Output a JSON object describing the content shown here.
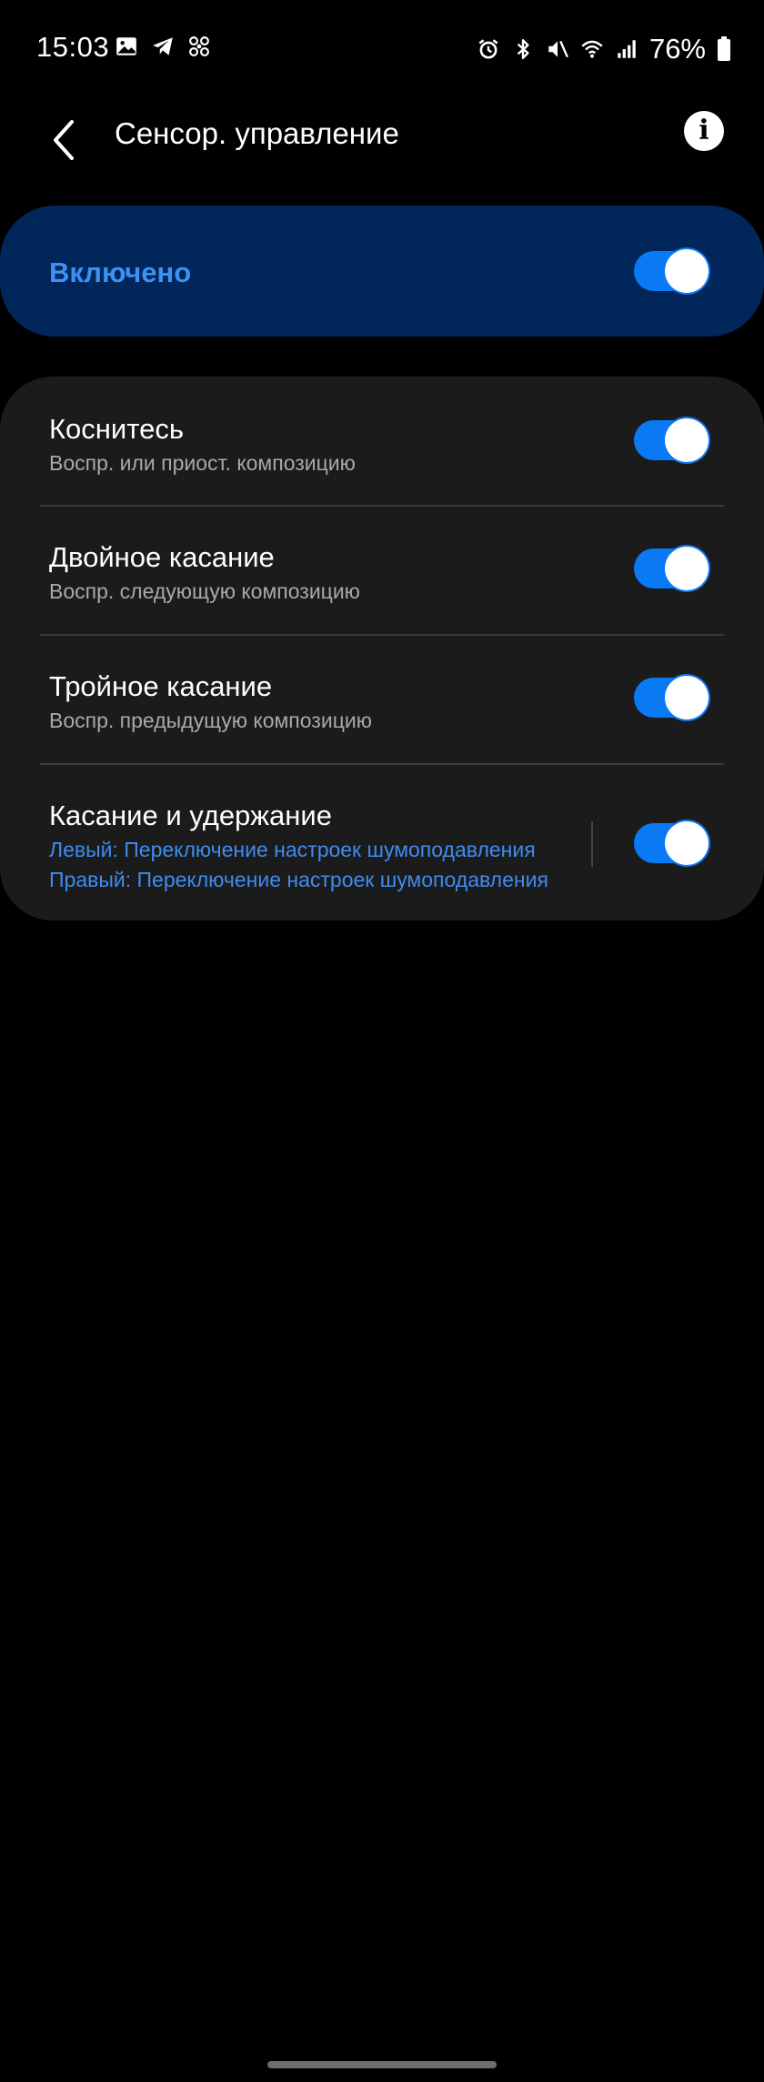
{
  "status_bar": {
    "time": "15:03",
    "left_icons": [
      "gallery-icon",
      "telegram-icon",
      "fan-icon"
    ],
    "right_icons": [
      "alarm-icon",
      "bluetooth-icon",
      "mute-icon",
      "wifi-icon",
      "signal-icon"
    ],
    "battery": "76%"
  },
  "header": {
    "title": "Сенсор. управление",
    "back_icon": "chevron-left-icon",
    "info_icon": "info-icon"
  },
  "master": {
    "label": "Включено",
    "enabled": true
  },
  "items": [
    {
      "title": "Коснитесь",
      "subtitle": "Воспр. или приост. композицию",
      "enabled": true
    },
    {
      "title": "Двойное касание",
      "subtitle": "Воспр. следующую композицию",
      "enabled": true
    },
    {
      "title": "Тройное касание",
      "subtitle": "Воспр. предыдущую композицию",
      "enabled": true
    },
    {
      "title": "Касание и удержание",
      "subtitle_left": "Левый: Переключение настроек шумоподавления",
      "subtitle_right": "Правый: Переключение настроек шумоподавления",
      "enabled": true
    }
  ],
  "colors": {
    "background": "#000000",
    "master_card": "#00265a",
    "accent": "#0a7af4",
    "label_blue": "#3e91f4",
    "card": "#1b1b1b"
  }
}
